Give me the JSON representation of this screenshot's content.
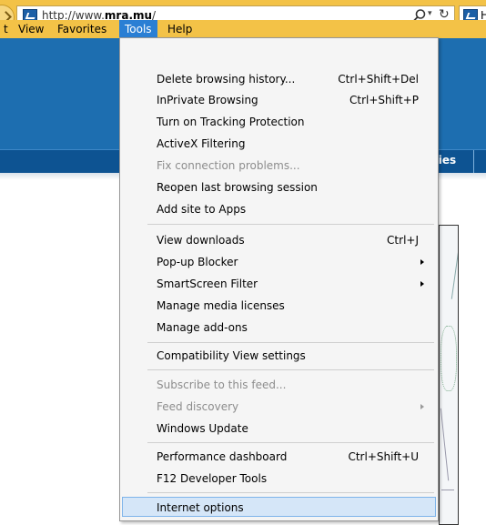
{
  "browser": {
    "url_prefix": "http://www.",
    "url_domain": "mra.mu",
    "url_suffix": "/",
    "tab_title_fragment": "H"
  },
  "menubar": {
    "items": [
      {
        "label": "t"
      },
      {
        "label": "View"
      },
      {
        "label": "Favorites"
      },
      {
        "label": "Tools"
      },
      {
        "label": "Help"
      }
    ],
    "active_item": "Tools"
  },
  "page": {
    "nav_label": "ties"
  },
  "tools_menu": {
    "items": [
      {
        "label": "Delete browsing history...",
        "shortcut": "Ctrl+Shift+Del",
        "enabled": true,
        "submenu": false
      },
      {
        "label": "InPrivate Browsing",
        "shortcut": "Ctrl+Shift+P",
        "enabled": true,
        "submenu": false
      },
      {
        "label": "Turn on Tracking Protection",
        "shortcut": "",
        "enabled": true,
        "submenu": false
      },
      {
        "label": "ActiveX Filtering",
        "shortcut": "",
        "enabled": true,
        "submenu": false
      },
      {
        "label": "Fix connection problems...",
        "shortcut": "",
        "enabled": false,
        "submenu": false
      },
      {
        "label": "Reopen last browsing session",
        "shortcut": "",
        "enabled": true,
        "submenu": false
      },
      {
        "label": "Add site to Apps",
        "shortcut": "",
        "enabled": true,
        "submenu": false
      },
      {
        "label": "View downloads",
        "shortcut": "Ctrl+J",
        "enabled": true,
        "submenu": false
      },
      {
        "label": "Pop-up Blocker",
        "shortcut": "",
        "enabled": true,
        "submenu": true
      },
      {
        "label": "SmartScreen Filter",
        "shortcut": "",
        "enabled": true,
        "submenu": true
      },
      {
        "label": "Manage media licenses",
        "shortcut": "",
        "enabled": true,
        "submenu": false
      },
      {
        "label": "Manage add-ons",
        "shortcut": "",
        "enabled": true,
        "submenu": false
      },
      {
        "label": "Compatibility View settings",
        "shortcut": "",
        "enabled": true,
        "submenu": false
      },
      {
        "label": "Subscribe to this feed...",
        "shortcut": "",
        "enabled": false,
        "submenu": false
      },
      {
        "label": "Feed discovery",
        "shortcut": "",
        "enabled": false,
        "submenu": true
      },
      {
        "label": "Windows Update",
        "shortcut": "",
        "enabled": true,
        "submenu": false
      },
      {
        "label": "Performance dashboard",
        "shortcut": "Ctrl+Shift+U",
        "enabled": true,
        "submenu": false
      },
      {
        "label": "F12 Developer Tools",
        "shortcut": "",
        "enabled": true,
        "submenu": false
      },
      {
        "label": "Internet options",
        "shortcut": "",
        "enabled": true,
        "submenu": false
      }
    ],
    "highlighted_item": "Internet options"
  },
  "colors": {
    "chrome": "#f3c247",
    "menu_active": "#2a7fd4",
    "site_header": "#1d6eb0",
    "site_nav": "#0d5392",
    "menu_highlight": "#d5e6f8",
    "disabled_text": "#8d8d8d"
  },
  "icons": {
    "site_favicon": "mra-logo-icon",
    "search": "search-icon",
    "dropdown": "chevron-down-icon",
    "refresh": "refresh-icon",
    "back": "back-arrow-icon",
    "submenu": "submenu-arrow-icon"
  }
}
